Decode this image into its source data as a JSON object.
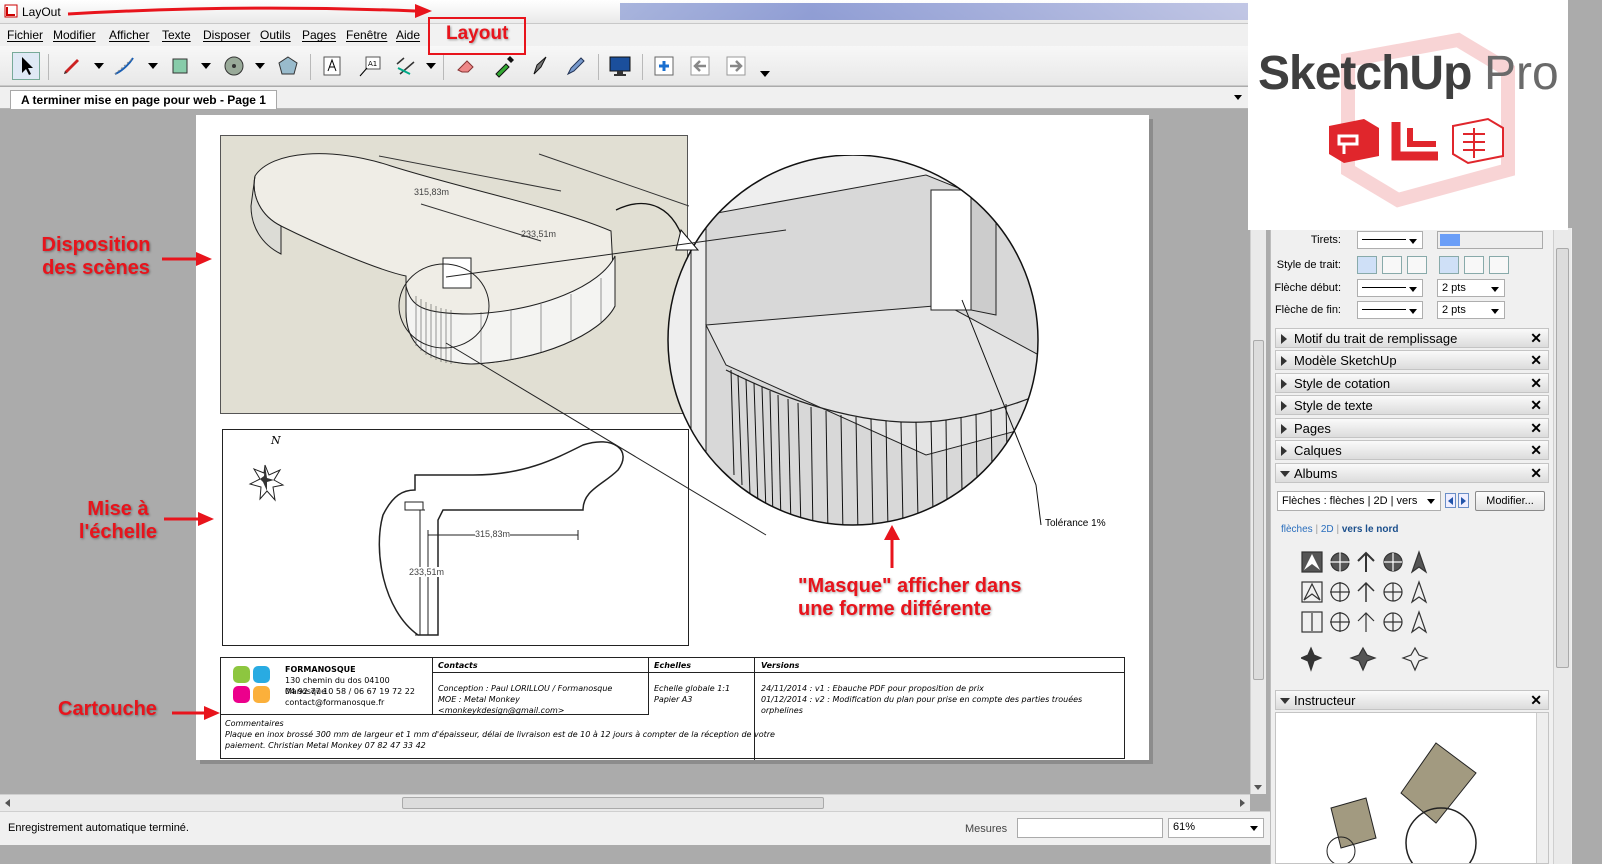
{
  "window": {
    "title": "LayOut"
  },
  "menu": [
    "Fichier",
    "Modifier",
    "Afficher",
    "Texte",
    "Disposer",
    "Outils",
    "Pages",
    "Fenêtre",
    "Aide"
  ],
  "doc_tab": "A terminer mise en page pour web - Page 1",
  "annotations": {
    "layout": "Layout",
    "disposition_1": "Disposition",
    "disposition_2": "des scènes",
    "echelle_1": "Mise à",
    "echelle_2": "l'échelle",
    "cartouche": "Cartouche",
    "masque_1": "\"Masque\" afficher dans",
    "masque_2": "une forme différente"
  },
  "drawing": {
    "dim_top": "315,83m",
    "dim_side": "233,51m",
    "dim_plan_h": "315,83m",
    "dim_plan_v": "233,51m",
    "north": "N",
    "tolerance": "Tolérance 1%"
  },
  "title_block": {
    "company": "FORMANOSQUE",
    "address_1": "130 chemin du dos 04100 Manosque",
    "address_2": "04 92 77 10 58 / 06 67 19 72 22",
    "address_3": "contact@formanosque.fr",
    "contacts_head": "Contacts",
    "contacts_1": "Conception : Paul LORILLOU / Formanosque",
    "contacts_2": "MOE : Metal Monkey <monkeykdesign@gmail.com>",
    "echelles_head": "Echelles",
    "echelles_1": "Echelle globale 1:1",
    "echelles_2": "Papier A3",
    "versions_head": "Versions",
    "versions_1": "24/11/2014 : v1 : Ebauche PDF pour proposition de prix",
    "versions_2": "01/12/2014 : v2 : Modification du plan pour prise en compte des parties trouées orphelines",
    "comments_head": "Commentaires",
    "comments_1": "Plaque en inox brossé 300 mm de largeur et 1 mm d'épaisseur, délai de livraison est de 10 à 12 jours à compter de la réception de votre",
    "comments_2": "paiement. Christian Metal Monkey 07 82 47 33 42"
  },
  "logo": {
    "brand": "SketchUp",
    "suffix": "Pro"
  },
  "panel": {
    "tirets_label": "Tirets:",
    "style_trait_label": "Style de trait:",
    "fleche_debut_label": "Flèche début:",
    "fleche_fin_label": "Flèche de fin:",
    "fleche_debut_size": "2 pts",
    "fleche_fin_size": "2 pts",
    "sections": [
      "Motif du trait de remplissage",
      "Modèle SketchUp",
      "Style de cotation",
      "Style de texte",
      "Pages",
      "Calques",
      "Albums"
    ],
    "albums_select": "Flèches : flèches | 2D | vers",
    "modifier_button": "Modifier...",
    "breadcrumb": [
      "flèches",
      "2D",
      "vers le nord"
    ],
    "instructeur": "Instructeur"
  },
  "status": {
    "message": "Enregistrement automatique terminé.",
    "mesures_label": "Mesures",
    "zoom": "61%"
  }
}
